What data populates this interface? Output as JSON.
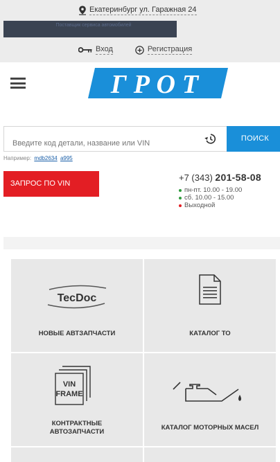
{
  "topbar": {
    "location": "Екатеринбург ул. Гаражная 24",
    "banner_text": "Поставщик сервиса автомобилей",
    "login_label": "Вход",
    "register_label": "Регистрация"
  },
  "header": {
    "logo_text": "ГРОТ"
  },
  "search": {
    "placeholder": "Введите код детали, название или VIN",
    "button_label": "ПОИСК",
    "example_prefix": "Например:",
    "examples": [
      "mdb2634",
      "a995"
    ]
  },
  "vin_request": {
    "label": "ЗАПРОС ПО VIN"
  },
  "contacts": {
    "phone_code": "+7 (343)",
    "phone_number": "201-58-08",
    "hours": [
      {
        "text": "пн-пт. 10.00 - 19.00",
        "color": "#2e9b3c"
      },
      {
        "text": "сб. 10.00 - 15.00",
        "color": "#2e9b3c"
      },
      {
        "text": "Выходной",
        "color": "#e31e24"
      }
    ]
  },
  "catalog": {
    "tiles": [
      {
        "label": "НОВЫЕ АВТЗАПЧАСТИ",
        "icon": "tecdoc-logo-icon",
        "icon_text": "TecDoc"
      },
      {
        "label": "КАТАЛОГ ТО",
        "icon": "document-icon"
      },
      {
        "label": "КОНТРАКТНЫЕ\nАВТОЗАПЧАСТИ",
        "icon": "vin-frame-icon",
        "icon_text_1": "VIN",
        "icon_text_2": "FRAME"
      },
      {
        "label": "КАТАЛОГ МОТОРНЫХ МАСЕЛ",
        "icon": "oil-can-icon"
      }
    ]
  },
  "colors": {
    "accent_blue": "#1a8fd9",
    "accent_red": "#e31e24",
    "logo_blue": "#1a8fd9"
  }
}
